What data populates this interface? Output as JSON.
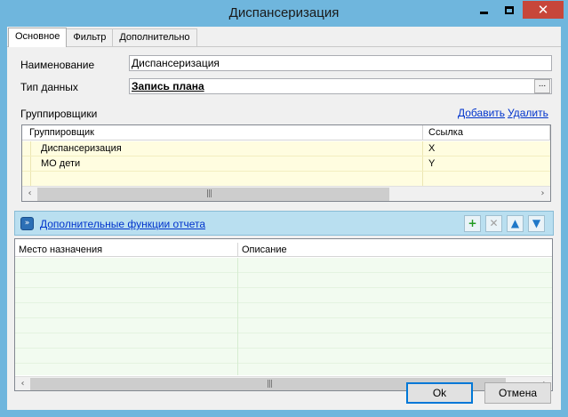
{
  "window": {
    "title": "Диспансеризация"
  },
  "tabs": [
    {
      "label": "Основное",
      "active": true
    },
    {
      "label": "Фильтр",
      "active": false
    },
    {
      "label": "Дополнительно",
      "active": false
    }
  ],
  "form": {
    "name_label": "Наименование",
    "name_value": "Диспансеризация",
    "type_label": "Тип данных",
    "type_value": "Запись плана",
    "type_button": "..."
  },
  "groupers": {
    "label": "Группировщики",
    "add_link": "Добавить",
    "delete_link": "Удалить",
    "columns": [
      "Группировщик",
      "Ссылка"
    ],
    "rows": [
      {
        "name": "Диспансеризация",
        "ref": "X"
      },
      {
        "name": "МО дети",
        "ref": "Y"
      }
    ]
  },
  "extra_panel": {
    "link_label": "Дополнительные функции отчета",
    "buttons": [
      "add-icon",
      "remove-icon",
      "move-up-icon",
      "move-down-icon"
    ]
  },
  "destinations": {
    "columns": [
      "Место назначения",
      "Описание"
    ]
  },
  "footer": {
    "ok_label": "Ok",
    "cancel_label": "Отмена"
  },
  "colors": {
    "titlebar": "#6fb6dd",
    "close_button": "#c7463a",
    "grouper_rows": "#fffde0",
    "panel_bar": "#b9dff0",
    "destination_rows": "#f2fbf0",
    "link": "#0033cc"
  }
}
